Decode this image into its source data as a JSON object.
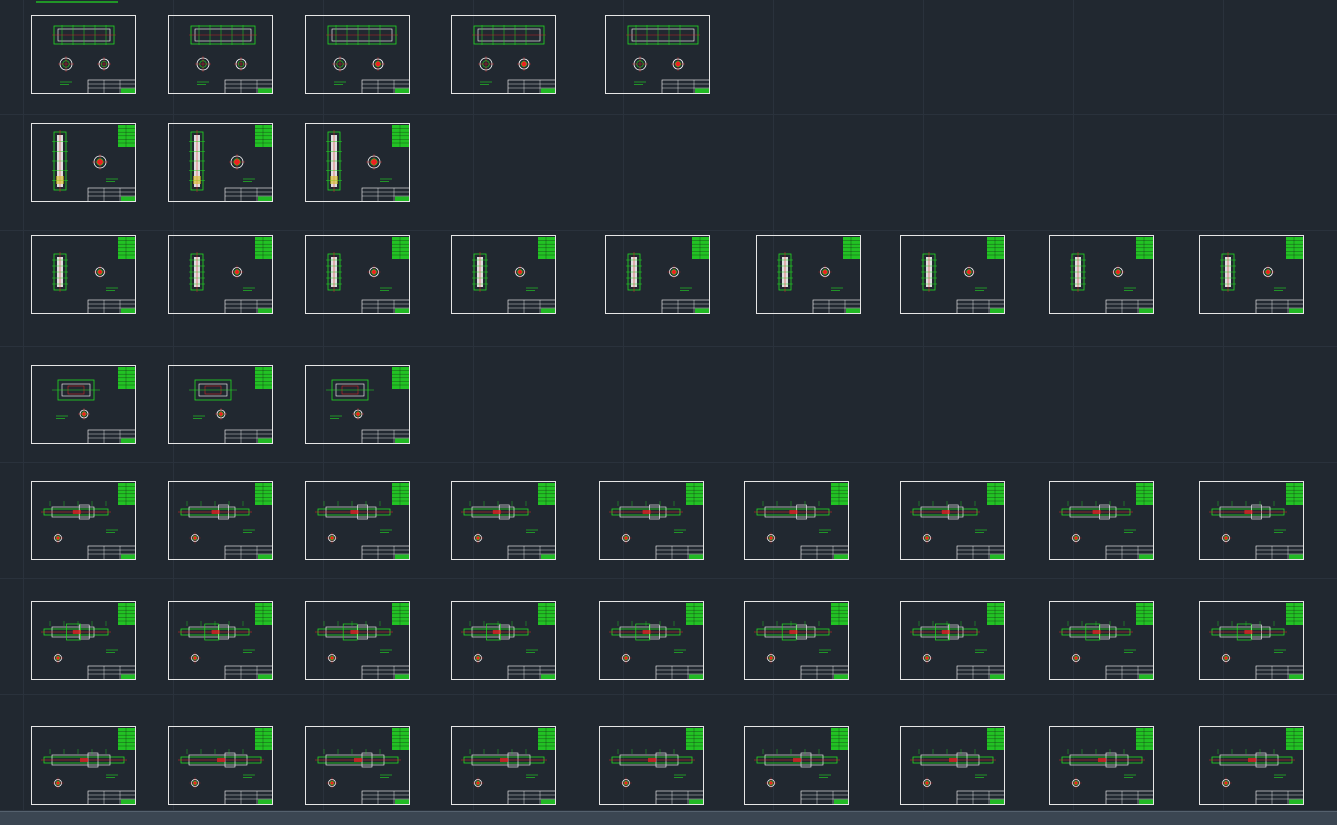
{
  "app": {
    "title": ""
  },
  "colors": {
    "background": "#212830",
    "grid": "#2a323c",
    "sheet_border": "#e6e6e6",
    "drawing_green": "#22dd22",
    "drawing_white": "#ffffff",
    "drawing_red": "#ee2222",
    "drawing_yellow": "#d7c020"
  },
  "icons": {
    "sheet": "drawing-sheet-icon",
    "title_block": "title-block-icon",
    "parts_table": "parts-table-icon"
  },
  "sheet_types": [
    "assembly",
    "vertical",
    "vertical-small",
    "gearbox",
    "shaft",
    "shaft-hub",
    "shaft-long"
  ],
  "rows": [
    {
      "type": "assembly",
      "count": 5
    },
    {
      "type": "vertical",
      "count": 3
    },
    {
      "type": "vertical-small",
      "count": 9
    },
    {
      "type": "gearbox",
      "count": 3
    },
    {
      "type": "shaft",
      "count": 9
    },
    {
      "type": "shaft-hub",
      "count": 9
    },
    {
      "type": "shaft-long",
      "count": 9
    }
  ]
}
